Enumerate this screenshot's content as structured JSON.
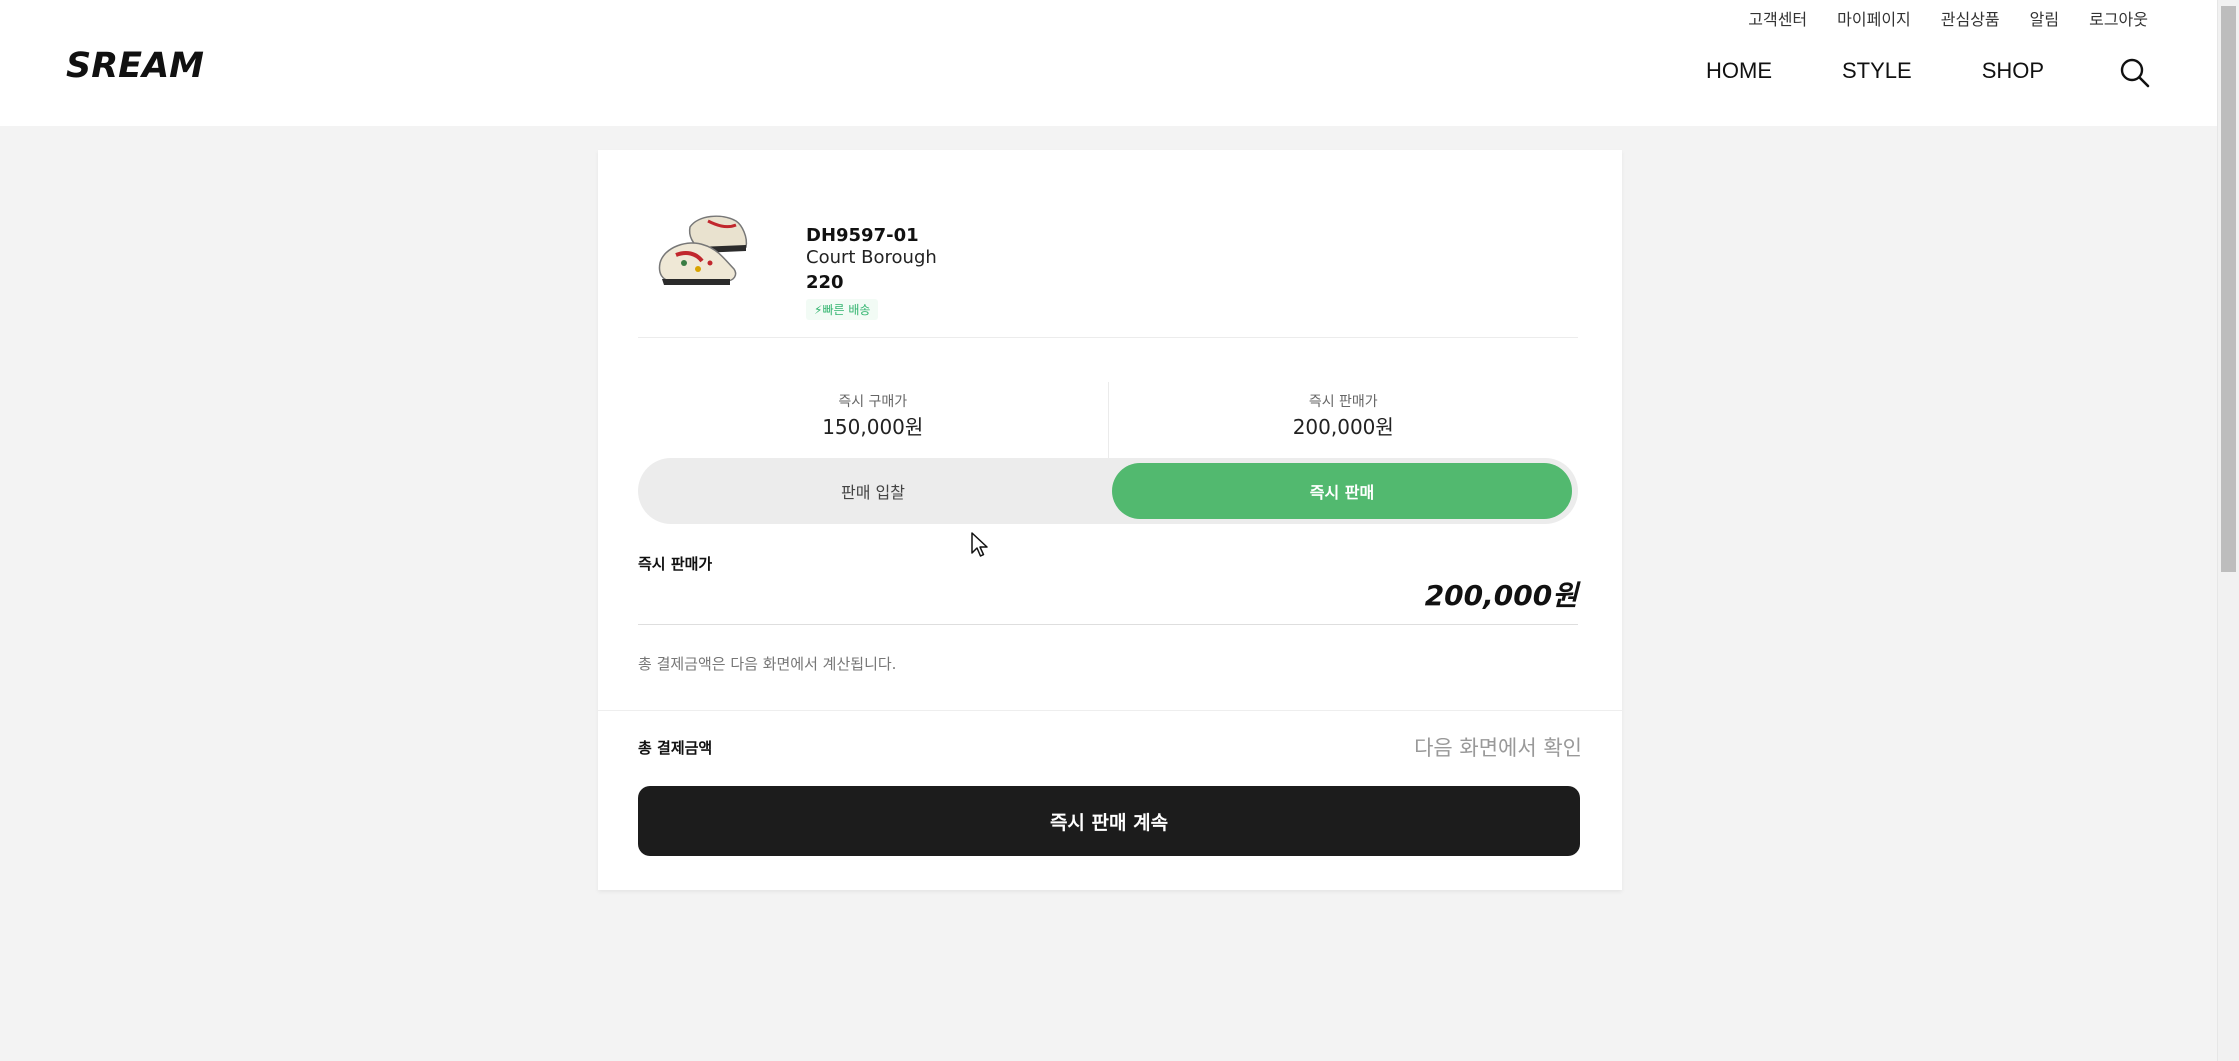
{
  "header": {
    "util_links": [
      "고객센터",
      "마이페이지",
      "관심상품",
      "알림",
      "로그아웃"
    ],
    "logo": "SREAM",
    "nav": [
      "HOME",
      "STYLE",
      "SHOP"
    ],
    "search_icon": "search-icon"
  },
  "product": {
    "model": "DH9597-01",
    "name": "Court Borough",
    "size": "220",
    "badge": "빠른 배송",
    "badge_icon": "lightning-icon"
  },
  "prices": {
    "buy_label": "즉시 구매가",
    "buy_value": "150,000원",
    "sell_label": "즉시 판매가",
    "sell_value": "200,000원"
  },
  "tabs": {
    "bid": "판매 입찰",
    "instant": "즉시 판매",
    "active": "instant"
  },
  "instant_sell": {
    "label": "즉시 판매가",
    "price": "200,000원",
    "note": "총 결제금액은 다음 화면에서 계산됩니다."
  },
  "total": {
    "label": "총 결제금액",
    "value": "다음 화면에서 확인"
  },
  "cta": "즉시 판매 계속",
  "colors": {
    "accent": "#52b96f",
    "cta": "#1c1c1c",
    "background": "#f3f3f3"
  }
}
